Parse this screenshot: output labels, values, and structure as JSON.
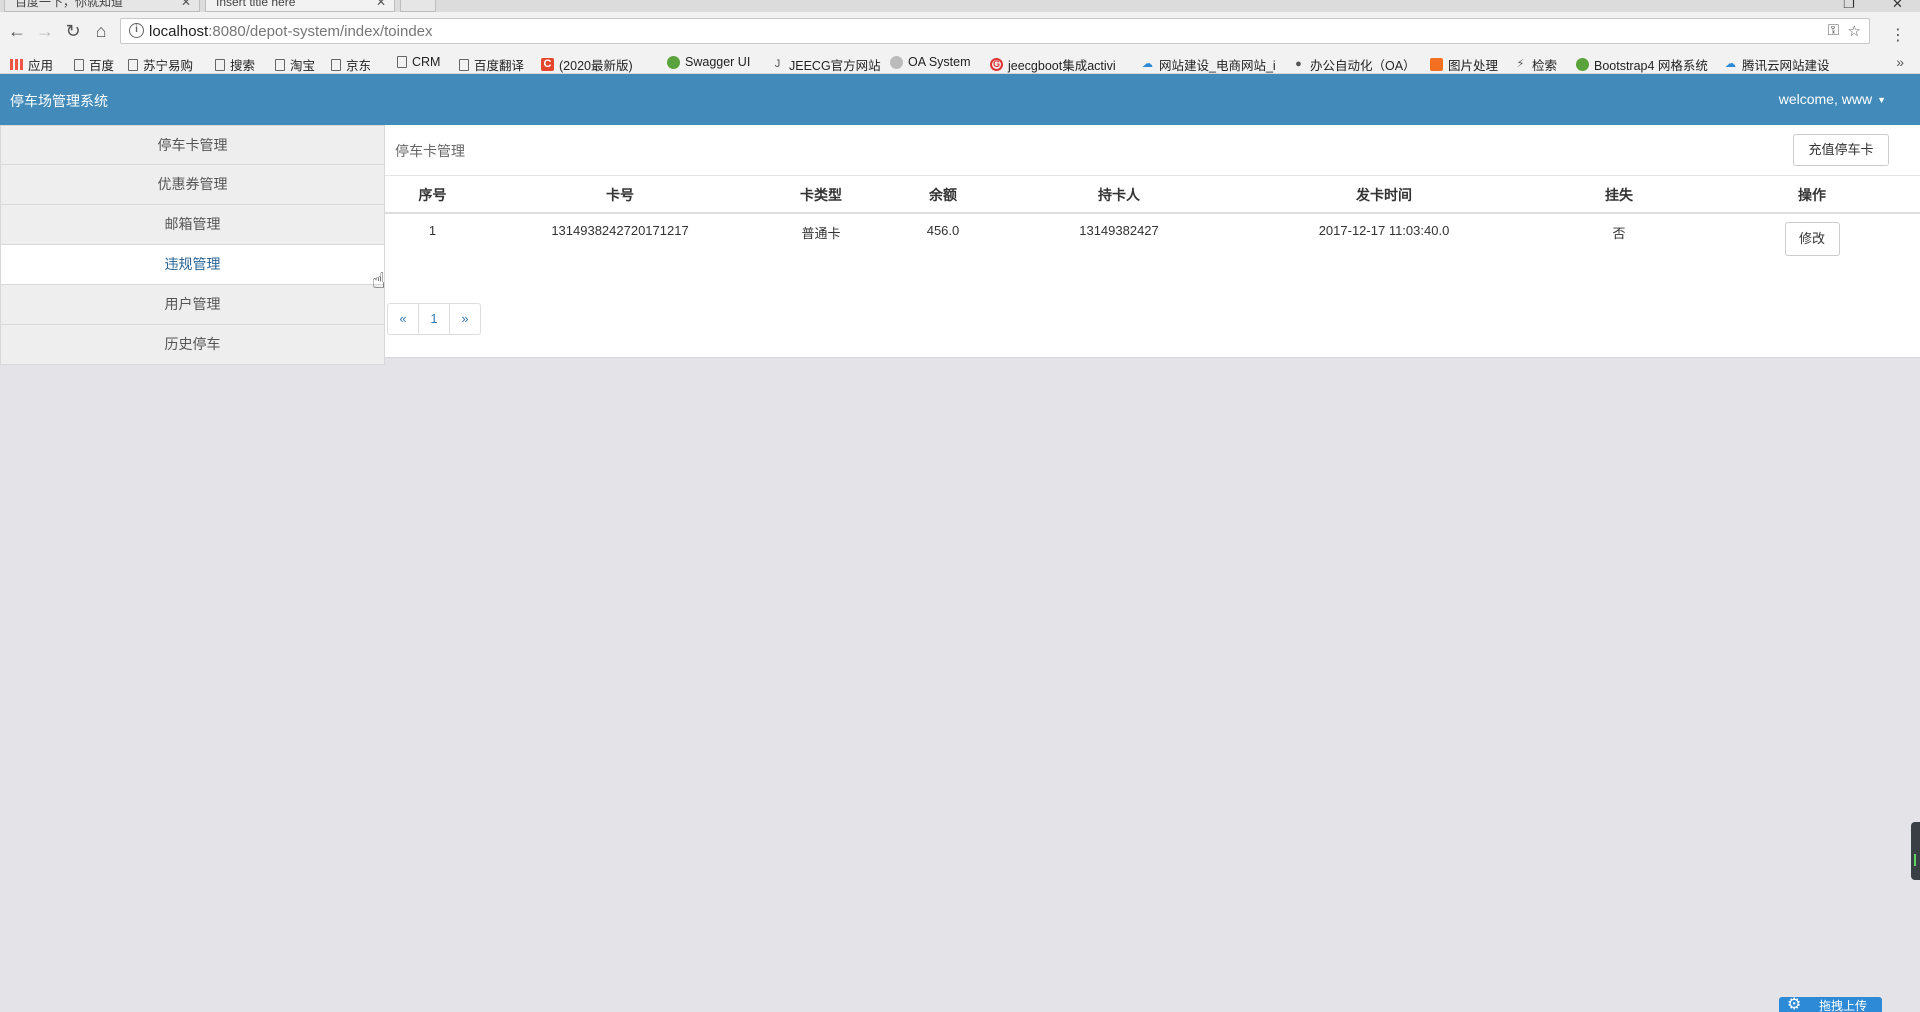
{
  "browser": {
    "tabs": [
      {
        "label": "百度一下，你就知道",
        "active": false
      },
      {
        "label": "Insert title here",
        "active": true
      }
    ],
    "url_host": "localhost",
    "url_path": ":8080/depot-system/index/toindex",
    "bookmarks": [
      {
        "label": "应用",
        "icon": "apps-icon"
      },
      {
        "label": "百度",
        "icon": "page-icon"
      },
      {
        "label": "苏宁易购",
        "icon": "page-icon"
      },
      {
        "label": "搜索",
        "icon": "page-icon"
      },
      {
        "label": "淘宝",
        "icon": "page-icon"
      },
      {
        "label": "京东",
        "icon": "page-icon"
      },
      {
        "label": "CRM",
        "icon": "page-icon"
      },
      {
        "label": "百度翻译",
        "icon": "page-icon"
      },
      {
        "label": "(2020最新版)",
        "icon": "csdn-icon"
      },
      {
        "label": "Swagger UI",
        "icon": "swagger-icon"
      },
      {
        "label": "JEECG官方网站",
        "icon": "jeecg-icon"
      },
      {
        "label": "OA System",
        "icon": "oa-icon"
      },
      {
        "label": "jeecgboot集成activi",
        "icon": "jeecg-boot-icon"
      },
      {
        "label": "网站建设_电商网站_i",
        "icon": "cloud-icon"
      },
      {
        "label": "办公自动化（OA）",
        "icon": "github-icon"
      },
      {
        "label": "图片处理",
        "icon": "image-icon"
      },
      {
        "label": "检索",
        "icon": "search-tool-icon"
      },
      {
        "label": "Bootstrap4 网格系统",
        "icon": "bootstrap-icon"
      },
      {
        "label": "腾讯云网站建设",
        "icon": "cloud-icon"
      }
    ]
  },
  "header": {
    "brand": "停车场管理系统",
    "welcome": "welcome, www"
  },
  "sidebar": {
    "items": [
      {
        "label": "停车卡管理"
      },
      {
        "label": "优惠券管理"
      },
      {
        "label": "邮箱管理"
      },
      {
        "label": "违规管理"
      },
      {
        "label": "用户管理"
      },
      {
        "label": "历史停车"
      }
    ]
  },
  "main": {
    "title": "停车卡管理",
    "recharge_label": "充值停车卡",
    "table": {
      "columns": [
        "序号",
        "卡号",
        "卡类型",
        "余额",
        "持卡人",
        "发卡时间",
        "挂失",
        "操作"
      ],
      "rows": [
        {
          "index": "1",
          "card_no": "1314938242720171217",
          "card_type": "普通卡",
          "balance": "456.0",
          "holder": "13149382427",
          "issue_time": "2017-12-17 11:03:40.0",
          "lost": "否",
          "action": "修改"
        }
      ]
    },
    "pagination": {
      "prev": "«",
      "current": "1",
      "next": "»"
    }
  },
  "widgets": {
    "upload_label": "拖拽上传"
  },
  "colors": {
    "header_bg": "#418ab9",
    "link": "#337ab7",
    "page_bg": "#e4e4e8"
  }
}
